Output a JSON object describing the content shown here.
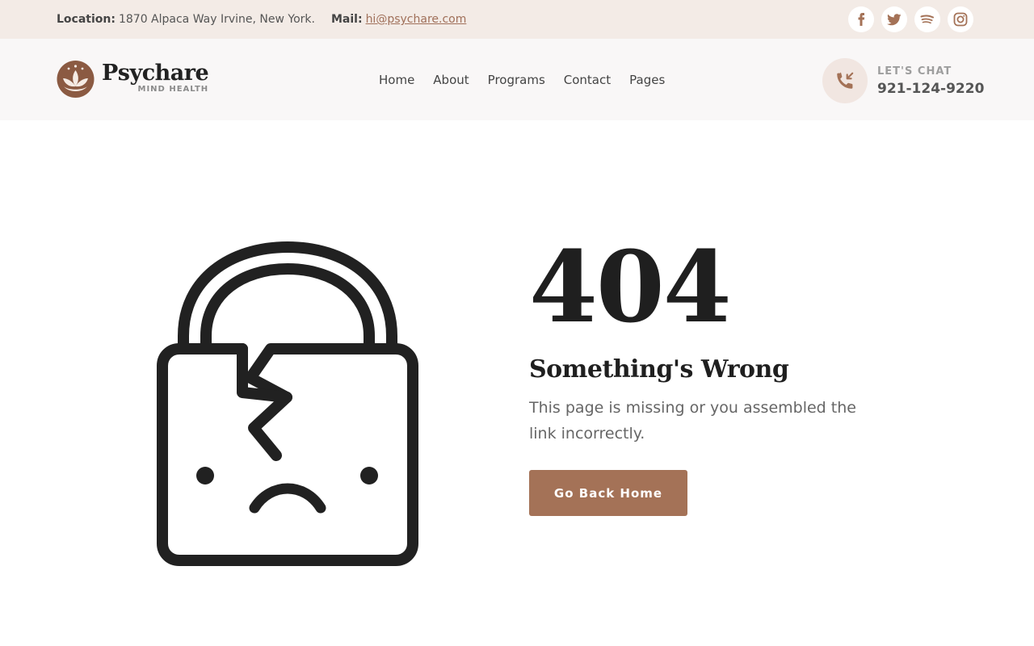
{
  "topbar": {
    "location_label": "Location:",
    "location_value": "1870 Alpaca Way Irvine, New York.",
    "mail_label": "Mail:",
    "mail_value": "hi@psychare.com",
    "socials": [
      "facebook-icon",
      "twitter-icon",
      "spotify-icon",
      "instagram-icon"
    ]
  },
  "header": {
    "brand_name": "Psychare",
    "brand_tagline": "MIND HEALTH",
    "nav": [
      "Home",
      "About",
      "Programs",
      "Contact",
      "Pages"
    ],
    "chat_label": "LET'S CHAT",
    "chat_number": "921-124-9220"
  },
  "main": {
    "code": "404",
    "headline": "Something's Wrong",
    "description": "This page is missing or you assembled the link incorrectly.",
    "button_label": "Go Back Home"
  },
  "colors": {
    "accent": "#a47257",
    "topbar_bg": "#f3ebe6",
    "header_bg": "#f9f7f7",
    "text_dark": "#1f1f1f"
  }
}
